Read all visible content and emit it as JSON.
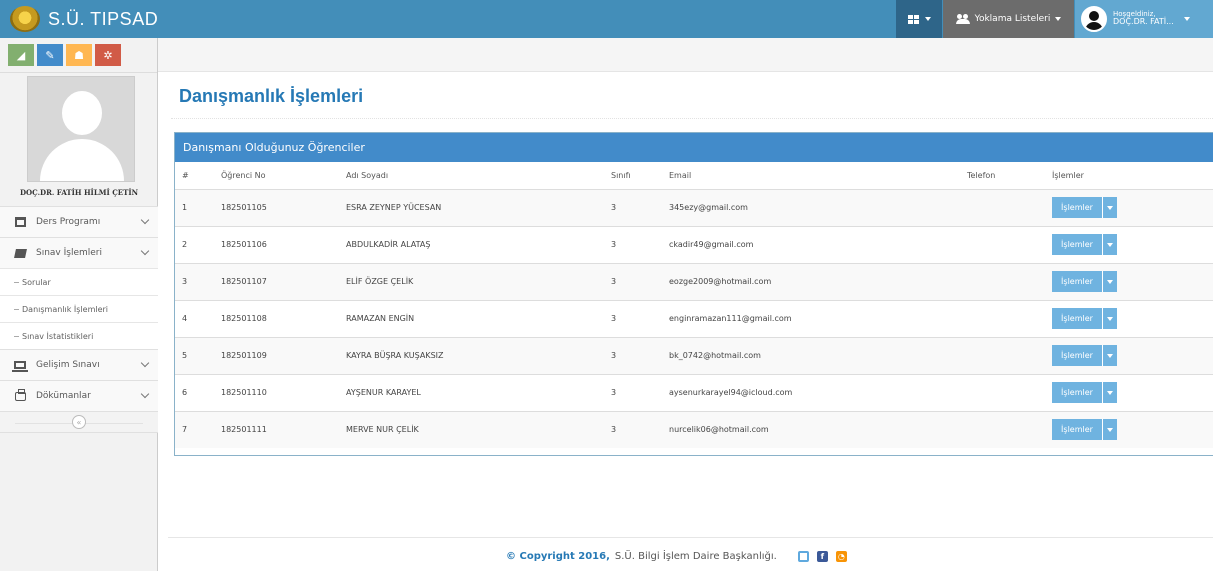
{
  "navbar": {
    "brand": "S.Ü. TIPSAD",
    "attendance_label": "Yoklama Listeleri",
    "user_greeting": "Hoşgeldiniz,",
    "user_name": "DOÇ.DR. FATİ..."
  },
  "sidebar": {
    "profile_name": "DOÇ.DR. FATİH HİLMİ ÇETİN",
    "menu": {
      "ders_programi": "Ders Programı",
      "sinav_islemleri": "Sınav İşlemleri",
      "sorular": "Sorular",
      "danismanlik": "Danışmanlık İşlemleri",
      "sinav_istatistikleri": "Sınav İstatistikleri",
      "gelisim_sinavi": "Gelişim Sınavı",
      "dokumanlar": "Dökümanlar"
    }
  },
  "page": {
    "title": "Danışmanlık İşlemleri",
    "panel_title": "Danışmanı Olduğunuz Öğrenciler"
  },
  "table": {
    "headers": [
      "#",
      "Öğrenci No",
      "Adı Soyadı",
      "Sınıfı",
      "Email",
      "Telefon",
      "İşlemler"
    ],
    "rows": [
      [
        "1",
        "182501105",
        "ESRA ZEYNEP YÜCESAN",
        "3",
        "345ezy@gmail.com",
        ""
      ],
      [
        "2",
        "182501106",
        "ABDULKADİR ALATAŞ",
        "3",
        "ckadir49@gmail.com",
        ""
      ],
      [
        "3",
        "182501107",
        "ELİF ÖZGE ÇELİK",
        "3",
        "eozge2009@hotmail.com",
        ""
      ],
      [
        "4",
        "182501108",
        "RAMAZAN ENGİN",
        "3",
        "enginramazan111@gmail.com",
        ""
      ],
      [
        "5",
        "182501109",
        "KAYRA BÜŞRA KUŞAKSIZ",
        "3",
        "bk_0742@hotmail.com",
        ""
      ],
      [
        "6",
        "182501110",
        "AYŞENUR KARAYEL",
        "3",
        "aysenurkarayel94@icloud.com",
        ""
      ],
      [
        "7",
        "182501111",
        "MERVE NUR ÇELİK",
        "3",
        "nurcelik06@hotmail.com",
        ""
      ]
    ],
    "action_label": "İşlemler"
  },
  "footer": {
    "copyright": "© Copyright 2016,",
    "org": "S.Ü. Bilgi İşlem Daire Başkanlığı."
  },
  "colors": {
    "navbar": "#438eb9",
    "panel_header": "#428bca",
    "title": "#2679b5",
    "action_button": "#6fb3e0"
  },
  "icons": [
    "grid-icon",
    "users-icon",
    "avatar",
    "calendar-icon",
    "book-icon",
    "laptop-icon",
    "print-icon",
    "twitter-icon",
    "facebook-icon",
    "rss-icon"
  ]
}
